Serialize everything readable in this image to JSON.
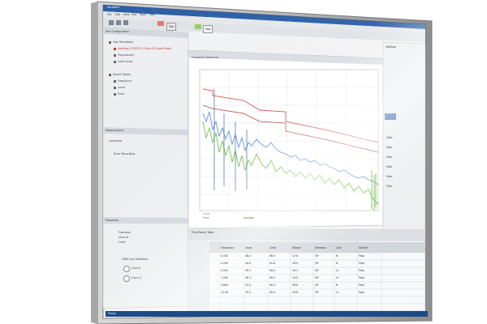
{
  "menu": {
    "app_label": "Hardware",
    "items": [
      "File",
      "Edit",
      "View",
      "Test",
      "Tools",
      "Help"
    ]
  },
  "toolbar": {
    "tabs": [
      "Tab",
      "Tab",
      "Tab"
    ]
  },
  "left_panel": {
    "title": "Test Configuration",
    "tree": [
      {
        "label": "Test Templates"
      },
      {
        "label": "Settings (CISPR 22 Class B Quasi-Peak)"
      },
      {
        "label": "Transducers"
      },
      {
        "label": "Limit Lines"
      },
      {
        "label": "Result Tables"
      },
      {
        "label": "Frequency"
      },
      {
        "label": "Level"
      },
      {
        "label": "Final"
      }
    ]
  },
  "measurement_panel": {
    "title": "Measurement",
    "items": [
      "Overview",
      "Scan Recording"
    ]
  },
  "properties_panel": {
    "title": "Properties",
    "lines": [
      "Filename",
      "Class B",
      "Limit"
    ],
    "section": "LISN Line Selection",
    "options": [
      "Line N",
      "Line L1"
    ]
  },
  "graph": {
    "title": "Frequency Spectrum",
    "legend": [
      "Limit",
      "Peak",
      "Average"
    ],
    "colors": {
      "limit_upper": "#d9534f",
      "limit_lower": "#c0392b",
      "peak": "#4a7fd6",
      "avg": "#6dbf3d"
    }
  },
  "results_table": {
    "title": "Final Result Table",
    "headers": [
      "Frequency",
      "Level",
      "Limit",
      "Margin",
      "Detector",
      "Line",
      "Verdict"
    ],
    "rows": [
      [
        "0.150",
        "48.2",
        "66.0",
        "17.8",
        "QP",
        "N",
        "Pass"
      ],
      [
        "0.250",
        "44.9",
        "61.8",
        "16.9",
        "QP",
        "N",
        "Pass"
      ],
      [
        "0.520",
        "39.7",
        "56.0",
        "16.3",
        "QP",
        "L1",
        "Pass"
      ],
      [
        "1.200",
        "36.1",
        "56.0",
        "19.9",
        "QP",
        "L1",
        "Pass"
      ],
      [
        "5.800",
        "33.4",
        "60.0",
        "26.6",
        "QP",
        "N",
        "Pass"
      ],
      [
        "12.40",
        "30.2",
        "60.0",
        "29.8",
        "QP",
        "L1",
        "Pass"
      ]
    ]
  },
  "right_panel": {
    "title": "Settings",
    "fields": [
      "Field",
      "Field",
      "Field",
      "Field",
      "Field",
      "Field"
    ]
  },
  "status_bar": {
    "text": "Ready"
  }
}
